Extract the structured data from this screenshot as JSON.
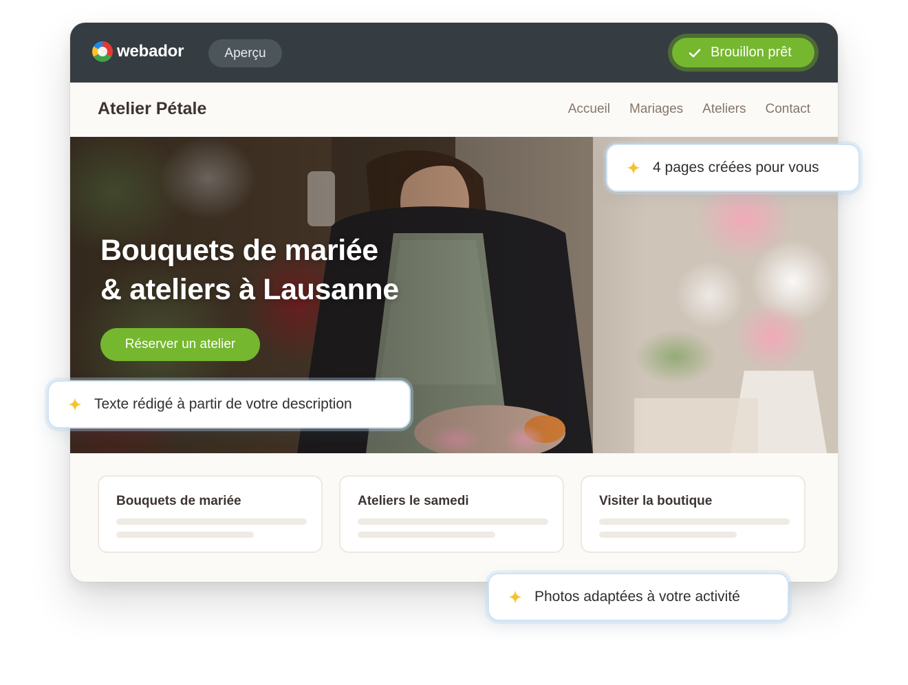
{
  "app": {
    "logo_text": "webador",
    "preview_label": "Aperçu",
    "draft_status": "Brouillon prêt",
    "accent_color": "#75b72f",
    "topbar_color": "#353d42"
  },
  "site": {
    "brand": "Atelier Pétale",
    "nav": [
      "Accueil",
      "Mariages",
      "Ateliers",
      "Contact"
    ],
    "hero": {
      "title_line1": "Bouquets de mariée",
      "title_line2": "& ateliers à Lausanne",
      "cta_label": "Réserver un atelier"
    },
    "cards": [
      {
        "title": "Bouquets de mariée"
      },
      {
        "title": "Ateliers le samedi"
      },
      {
        "title": "Visiter la boutique"
      }
    ]
  },
  "callouts": {
    "pages_created": "4 pages créées pour vous",
    "text_written": "Texte rédigé à partir de votre description",
    "photos_adapted": "Photos adaptées à votre activité"
  }
}
